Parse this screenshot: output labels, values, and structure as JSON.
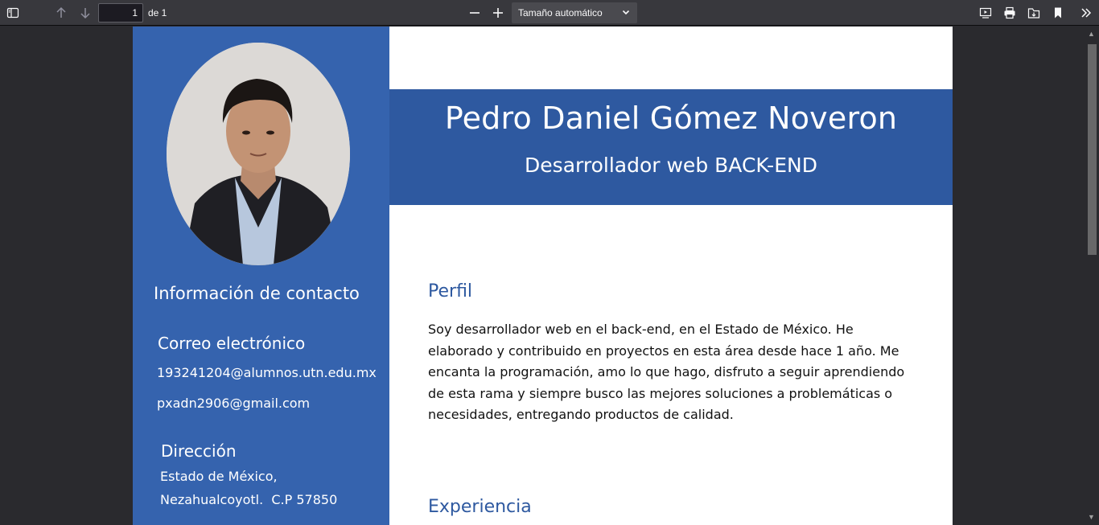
{
  "toolbar": {
    "page_number": "1",
    "page_of": "de 1",
    "zoom_label": "Tamaño automático"
  },
  "cv": {
    "name": "Pedro Daniel Gómez Noveron",
    "role": "Desarrollador web BACK-END",
    "sidebar": {
      "contact_heading": "Información de contacto",
      "email_heading": "Correo electrónico",
      "email_1": "193241204@alumnos.utn.edu.mx",
      "email_2": "pxadn2906@gmail.com",
      "address_heading": "Dirección",
      "address_line_1": "Estado de México,",
      "address_line_2": "Nezahualcoyotl.  C.P 57850"
    },
    "profile_heading": "Perfil",
    "profile_text": "Soy desarrollador web en el back-end, en el Estado de México. He elaborado y contribuido en proyectos en esta área desde hace 1 año. Me encanta la programación, amo lo que hago, disfruto a seguir aprendiendo de esta rama y siempre busco las mejores soluciones a problemáticas o necesidades, entregando productos de calidad.",
    "experience_heading": "Experiencia"
  },
  "colors": {
    "sidebar": "#3563ae",
    "banner": "#2e59a0",
    "heading": "#2e59a0"
  }
}
